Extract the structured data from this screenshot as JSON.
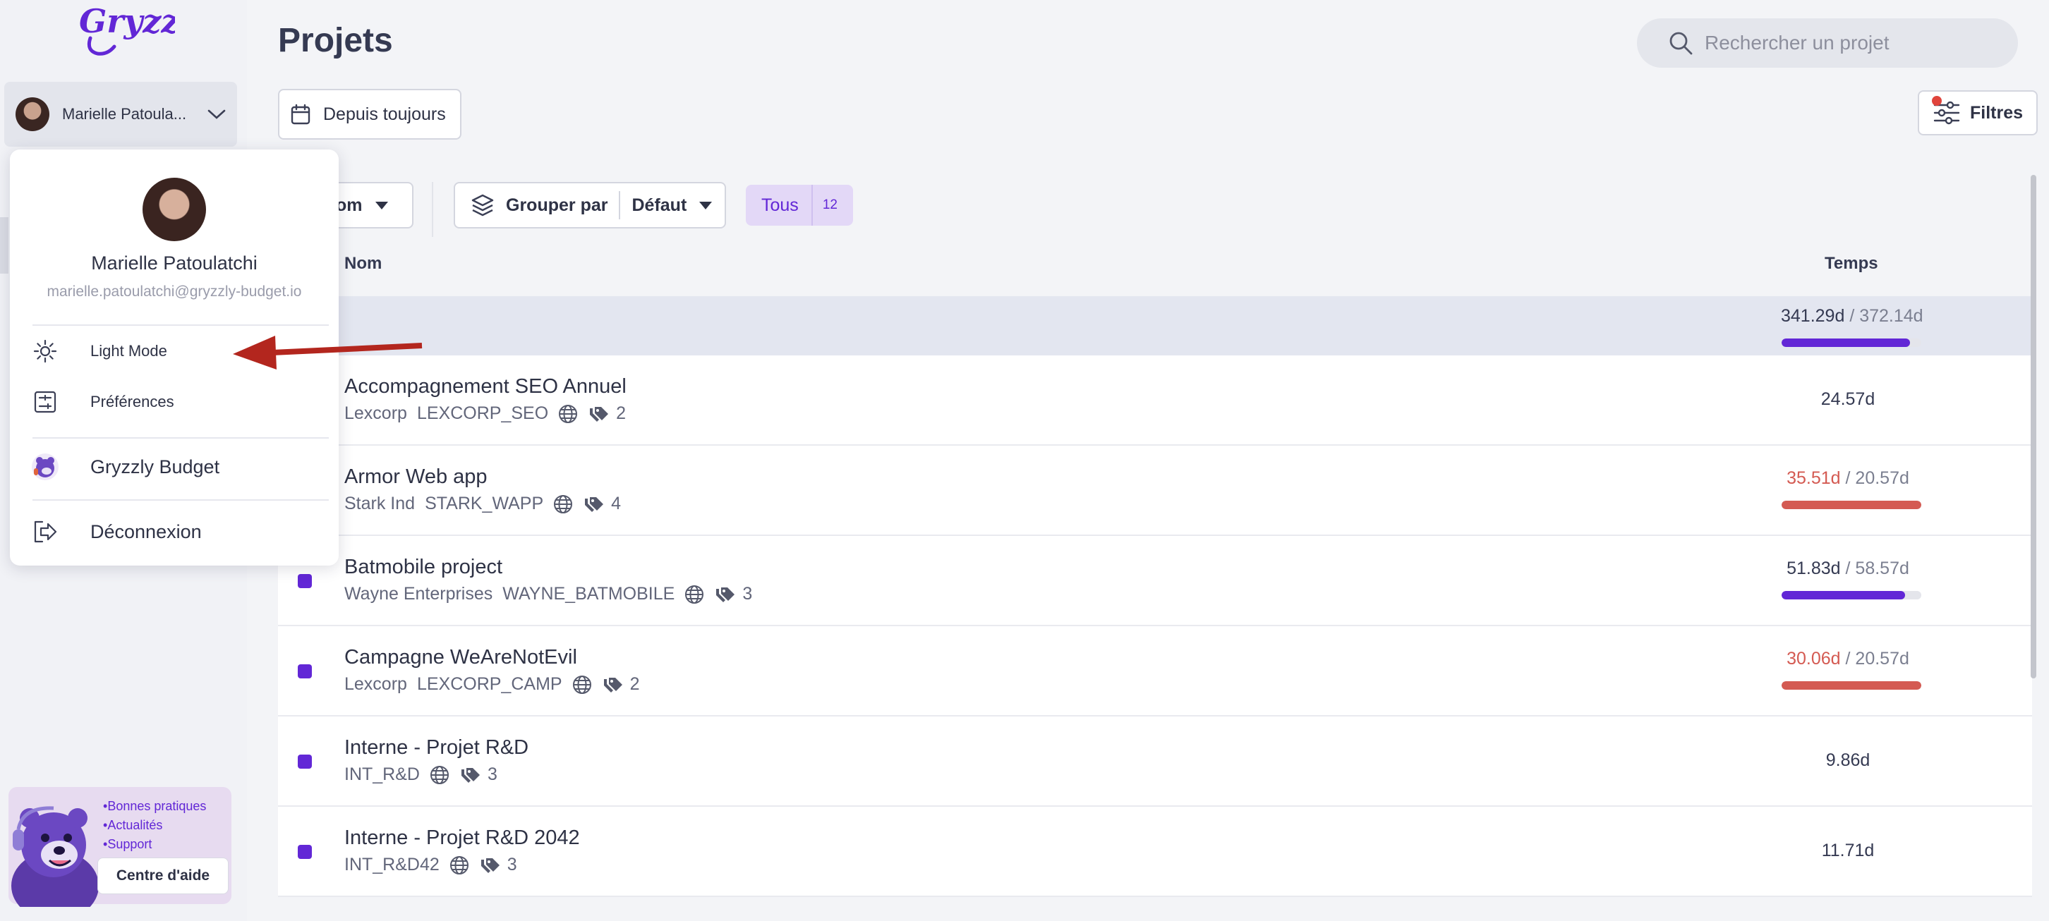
{
  "brand": {
    "logo_text": "Gryzzly"
  },
  "sidebar": {
    "user": {
      "name": "Marielle Patoula..."
    },
    "help": {
      "links": [
        "Bonnes pratiques",
        "Actualités",
        "Support"
      ],
      "button_label": "Centre d'aide"
    }
  },
  "user_menu": {
    "name": "Marielle Patoulatchi",
    "email": "marielle.patoulatchi@gryzzly-budget.io",
    "items": {
      "theme": "Light Mode",
      "preferences": "Préférences",
      "workspace": "Gryzzly Budget",
      "logout": "Déconnexion"
    }
  },
  "page": {
    "title": "Projets"
  },
  "search": {
    "placeholder": "Rechercher un projet"
  },
  "toolbar": {
    "date_filter": "Depuis toujours",
    "filters": "Filtres",
    "sort_value": "om",
    "group_label": "Grouper par",
    "group_value": "Défaut",
    "scope_label": "Tous",
    "scope_count": "12"
  },
  "table": {
    "columns": {
      "name": "Nom",
      "time": "Temps"
    },
    "total": {
      "spent": "341.29d",
      "budget": "372.14d",
      "progress": 0.917
    },
    "rows": [
      {
        "name": "Accompagnement SEO Annuel",
        "client": "Lexcorp",
        "code": "LEXCORP_SEO",
        "tags": "2",
        "spent": "24.57d"
      },
      {
        "name": "Armor Web app",
        "client": "Stark Ind",
        "code": "STARK_WAPP",
        "tags": "4",
        "spent": "35.51d",
        "budget": "20.57d",
        "over": true,
        "progress": 1.0
      },
      {
        "name": "Batmobile project",
        "client": "Wayne Enterprises",
        "code": "WAYNE_BATMOBILE",
        "tags": "3",
        "spent": "51.83d",
        "budget": "58.57d",
        "progress": 0.885
      },
      {
        "name": "Campagne WeAreNotEvil",
        "client": "Lexcorp",
        "code": "LEXCORP_CAMP",
        "tags": "2",
        "spent": "30.06d",
        "budget": "20.57d",
        "over": true,
        "progress": 1.0
      },
      {
        "name": "Interne - Projet R&D",
        "client": "",
        "code": "INT_R&D",
        "tags": "3",
        "spent": "9.86d"
      },
      {
        "name": "Interne - Projet R&D 2042",
        "client": "",
        "code": "INT_R&D42",
        "tags": "3",
        "spent": "11.71d"
      }
    ]
  },
  "colors": {
    "accent": "#6227d6",
    "over_budget": "#d45a52",
    "annotation_arrow": "#b3261e"
  }
}
